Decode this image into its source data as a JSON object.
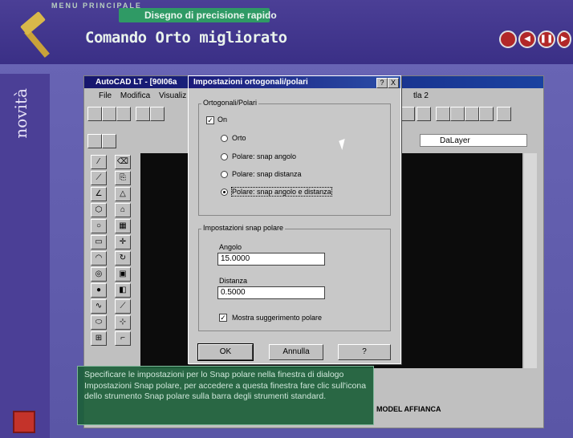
{
  "header": {
    "menu_label": "MENU PRINCIPALE",
    "subtitle": "Disegno di precisione rapido",
    "title": "Comando Orto migliorato"
  },
  "sidebar": {
    "label": "novità"
  },
  "app": {
    "window_title": "AutoCAD LT - [90I06a",
    "menu": [
      "File",
      "Modifica",
      "Visualiz"
    ],
    "menu_right": "tla 2",
    "layer_value": "DaLayer",
    "status_model": "MODEL  AFFIANCA"
  },
  "dialog": {
    "title": "Impostazioni ortogonali/polari",
    "help_btn": "?",
    "close_btn": "X",
    "group1_label": "Ortogonali/Polari",
    "on_label": "On",
    "options": [
      "Orto",
      "Polare: snap angolo",
      "Polare: snap distanza",
      "Polare: snap angolo e distanza"
    ],
    "selected_option": 3,
    "group2_label": "Impostazioni snap polare",
    "angle_label": "Angolo",
    "angle_value": "15.0000",
    "distance_label": "Distanza",
    "distance_value": "0.5000",
    "show_hint_label": "Mostra suggerimento polare",
    "ok": "OK",
    "cancel": "Annulla",
    "help": "?"
  },
  "caption": "Specificare le impostazioni per lo Snap polare nella finestra di dialogo Impostazioni Snap polare, per accedere a questa finestra fare clic sull'icona dello strumento Snap polare sulla barra degli strumenti standard.",
  "colors": {
    "accent_red": "#c4332a",
    "caption_green": "#1c603a",
    "frame_purple": "#5a56a6"
  }
}
